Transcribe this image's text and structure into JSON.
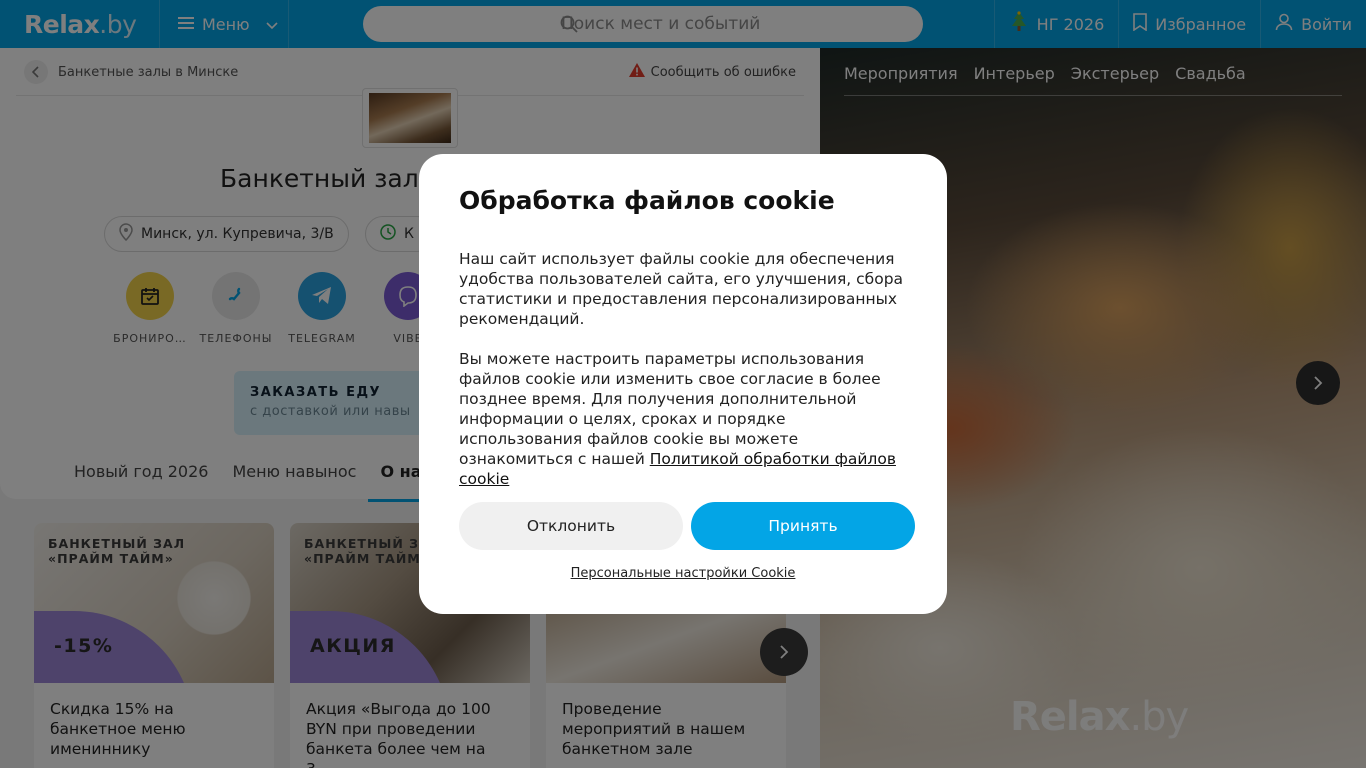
{
  "header": {
    "logo_text": "Relax",
    "logo_suffix": ".by",
    "menu_label": "Меню",
    "search_placeholder": "Поиск мест и событий",
    "ny_label": "НГ 2026",
    "favorites_label": "Избранное",
    "login_label": "Войти",
    "accent_color": "#03a5e6"
  },
  "breadcrumb": {
    "label": "Банкетные залы в Минске",
    "report_label": "Сообщить об ошибке"
  },
  "venue": {
    "title": "Банкетный зал",
    "address": "Минск, ул. Купревича, 3/В",
    "hours_partial": "К"
  },
  "actions": [
    {
      "label": "БРОНИРО…",
      "icon": "calendar-icon",
      "color": "#f3d34a"
    },
    {
      "label": "ТЕЛЕФОНЫ",
      "icon": "phone-icon",
      "color": "#e8e8e8"
    },
    {
      "label": "TELEGRAM",
      "icon": "telegram-icon",
      "color": "#2aa3e0"
    },
    {
      "label": "VIBE",
      "icon": "viber-icon",
      "color": "#7b5bd4"
    }
  ],
  "food_banner": {
    "title": "ЗАКАЗАТЬ ЕДУ",
    "subtitle": "с доставкой или навы"
  },
  "tabs": [
    {
      "label": "Новый год 2026",
      "active": false
    },
    {
      "label": "Меню навынос",
      "active": false
    },
    {
      "label": "О нас",
      "active": true
    }
  ],
  "promos": [
    {
      "tag_line1": "БАНКЕТНЫЙ ЗАЛ",
      "tag_line2": "«ПРАЙМ ТАЙМ»",
      "badge": "-15%",
      "text": "Скидка 15% на банкетное меню имениннику"
    },
    {
      "tag_line1": "БАНКЕТНЫЙ ЗАЛ",
      "tag_line2": "«ПРАЙМ ТАЙМ»",
      "badge": "АКЦИЯ",
      "text": "Акция «Выгода до 100 BYN при проведении банкета более чем на 3…"
    },
    {
      "tag_line1": "",
      "tag_line2": "",
      "badge": "",
      "text": "Проведение мероприятий в нашем банкетном зале"
    }
  ],
  "gallery": {
    "tabs": [
      "Мероприятия",
      "Интерьер",
      "Экстерьер",
      "Свадьба"
    ],
    "watermark_main": "Relax",
    "watermark_suffix": ".by"
  },
  "cookie_modal": {
    "title": "Обработка файлов cookie",
    "paragraph1": "Наш сайт использует файлы cookie для обеспечения удобства пользователей сайта, его улучшения, сбора статистики и предоставления персонализированных рекомендаций.",
    "paragraph2": "Вы можете настроить параметры использования файлов cookie или изменить свое согласие в более позднее время. Для получения дополнительной информации о целях, сроках и порядке использования файлов cookie вы можете ознакомиться с нашей",
    "policy_link": "Политикой обработки файлов cookie",
    "decline_label": "Отклонить",
    "accept_label": "Принять",
    "personal_settings_label": "Персональные настройки Cookie"
  }
}
